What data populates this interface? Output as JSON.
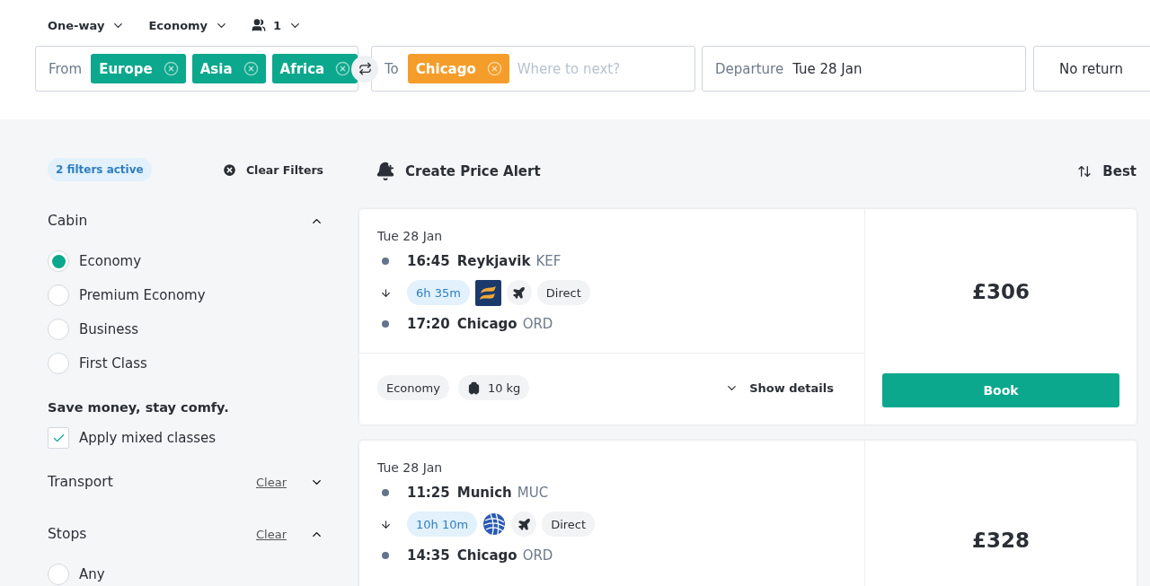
{
  "trip_options": [
    {
      "kind": "text",
      "label": "One-way"
    },
    {
      "kind": "text",
      "label": "Economy"
    },
    {
      "kind": "passengers",
      "label": "1"
    }
  ],
  "search": {
    "from": {
      "label": "From",
      "chips": [
        "Europe",
        "Asia",
        "Africa"
      ]
    },
    "to": {
      "label": "To",
      "chips": [
        "Chicago"
      ],
      "placeholder": "Where to next?"
    },
    "departure": {
      "label": "Departure",
      "value": "Tue 28 Jan"
    },
    "return": {
      "value": "No return"
    }
  },
  "filters": {
    "active_badge": "2 filters active",
    "clear_all": "Clear Filters",
    "sections": [
      {
        "title": "Cabin",
        "expanded": true,
        "options": [
          {
            "label": "Economy",
            "selected": true
          },
          {
            "label": "Premium Economy",
            "selected": false
          },
          {
            "label": "Business",
            "selected": false
          },
          {
            "label": "First Class",
            "selected": false
          }
        ],
        "note": "Save money, stay comfy.",
        "checkbox": {
          "label": "Apply mixed classes",
          "checked": true
        }
      },
      {
        "title": "Transport",
        "expanded": false,
        "clear": "Clear"
      },
      {
        "title": "Stops",
        "expanded": true,
        "clear": "Clear",
        "options": [
          {
            "label": "Any",
            "selected": false
          }
        ]
      }
    ]
  },
  "price_alert": "Create Price Alert",
  "sort": "Best",
  "results": [
    {
      "date": "Tue 28 Jan",
      "depart": {
        "time": "16:45",
        "city": "Reykjavik",
        "code": "KEF"
      },
      "arrive": {
        "time": "17:20",
        "city": "Chicago",
        "code": "ORD"
      },
      "duration": "6h 35m",
      "kind": "wave",
      "stops": "Direct",
      "cabin": "Economy",
      "baggage": "10 kg",
      "details": "Show details",
      "price": "£306",
      "book": "Book"
    },
    {
      "date": "Tue 28 Jan",
      "depart": {
        "time": "11:25",
        "city": "Munich",
        "code": "MUC"
      },
      "arrive": {
        "time": "14:35",
        "city": "Chicago",
        "code": "ORD"
      },
      "duration": "10h 10m",
      "kind": "globe",
      "stops": "Direct",
      "price": "£328"
    }
  ]
}
